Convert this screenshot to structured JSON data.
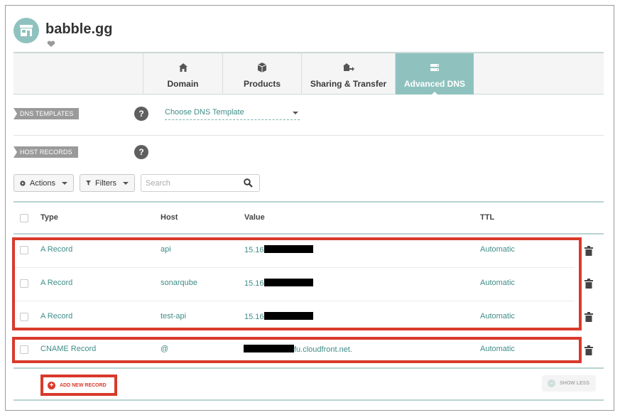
{
  "domain": {
    "name": "babble.gg"
  },
  "tabs": [
    {
      "label": "Domain",
      "icon": "home-icon"
    },
    {
      "label": "Products",
      "icon": "box-icon"
    },
    {
      "label": "Sharing & Transfer",
      "icon": "share-transfer-icon"
    },
    {
      "label": "Advanced DNS",
      "icon": "dns-icon",
      "active": true
    }
  ],
  "dns_templates": {
    "label": "DNS TEMPLATES",
    "select_value": "Choose DNS Template"
  },
  "host_records": {
    "label": "HOST RECORDS"
  },
  "toolbar": {
    "actions_label": "Actions",
    "filters_label": "Filters",
    "search_placeholder": "Search"
  },
  "table": {
    "columns": [
      "Type",
      "Host",
      "Value",
      "TTL"
    ],
    "rows": [
      {
        "type": "A Record",
        "host": "api",
        "value_prefix": "15.16",
        "value_suffix": "",
        "ttl": "Automatic"
      },
      {
        "type": "A Record",
        "host": "sonarqube",
        "value_prefix": "15.16",
        "value_suffix": "",
        "ttl": "Automatic"
      },
      {
        "type": "A Record",
        "host": "test-api",
        "value_prefix": "15.16",
        "value_suffix": "",
        "ttl": "Automatic"
      },
      {
        "type": "CNAME Record",
        "host": "@",
        "value_prefix": "",
        "value_suffix": "fu.cloudfront.net.",
        "ttl": "Automatic"
      }
    ]
  },
  "footer": {
    "add_label": "ADD NEW RECORD",
    "show_less_label": "SHOW LESS"
  },
  "colors": {
    "accent": "#8fc2bf",
    "link": "#3f8d88",
    "highlight": "#d93a2b"
  }
}
